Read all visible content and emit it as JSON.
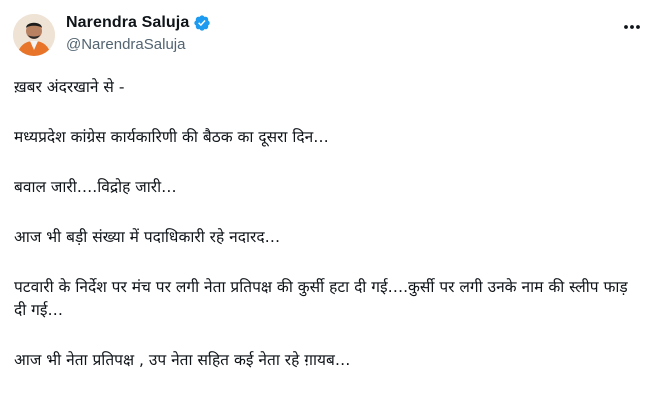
{
  "author": {
    "display_name": "Narendra Saluja",
    "handle": "@NarendraSaluja",
    "verified_color": "#1d9bf0",
    "avatar_icon": "profile-photo"
  },
  "more_icon": "more-horizontal-icon",
  "tweet": {
    "paragraphs": [
      "ख़बर अंदरखाने से -",
      "मध्यप्रदेश कांग्रेस कार्यकारिणी की बैठक का दूसरा दिन…",
      "बवाल जारी….विद्रोह जारी…",
      "आज भी बड़ी संख्या में पदाधिकारी रहे नदारद…",
      "पटवारी के निर्देश पर मंच पर लगी नेता प्रतिपक्ष की कुर्सी हटा दी गई….कुर्सी पर लगी उनके नाम की स्लीप फाड़ दी गई…",
      "आज भी नेता प्रतिपक्ष , उप नेता सहित कई नेता रहे ग़ायब…"
    ]
  }
}
